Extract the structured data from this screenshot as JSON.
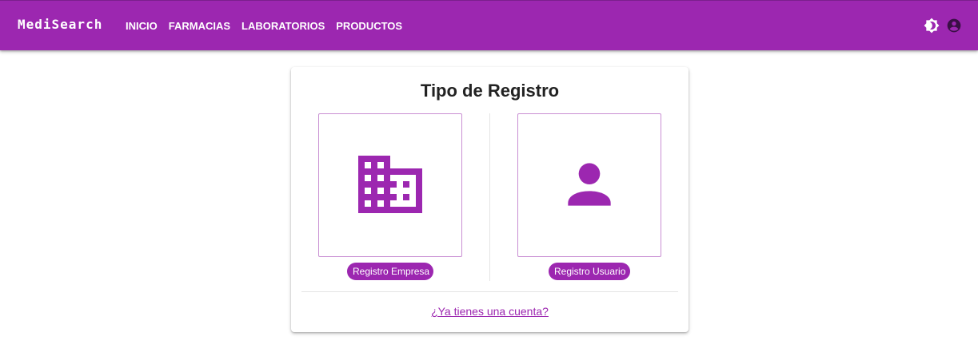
{
  "app": {
    "brand": "MediSearch"
  },
  "nav": {
    "links": [
      {
        "label": "INICIO"
      },
      {
        "label": "FARMACIAS"
      },
      {
        "label": "LABORATORIOS"
      },
      {
        "label": "PRODUCTOS"
      }
    ],
    "icons": [
      "brightness-icon",
      "account-circle-icon"
    ]
  },
  "registro": {
    "title": "Tipo de Registro",
    "options": [
      {
        "icon": "building-icon",
        "label": "Registro Empresa"
      },
      {
        "icon": "person-icon",
        "label": "Registro Usuario"
      }
    ],
    "login_link": "¿Ya tienes una cuenta?"
  },
  "colors": {
    "primary": "#9c27b0",
    "box_border": "#c98fd3",
    "divider": "#e4e4e4"
  }
}
